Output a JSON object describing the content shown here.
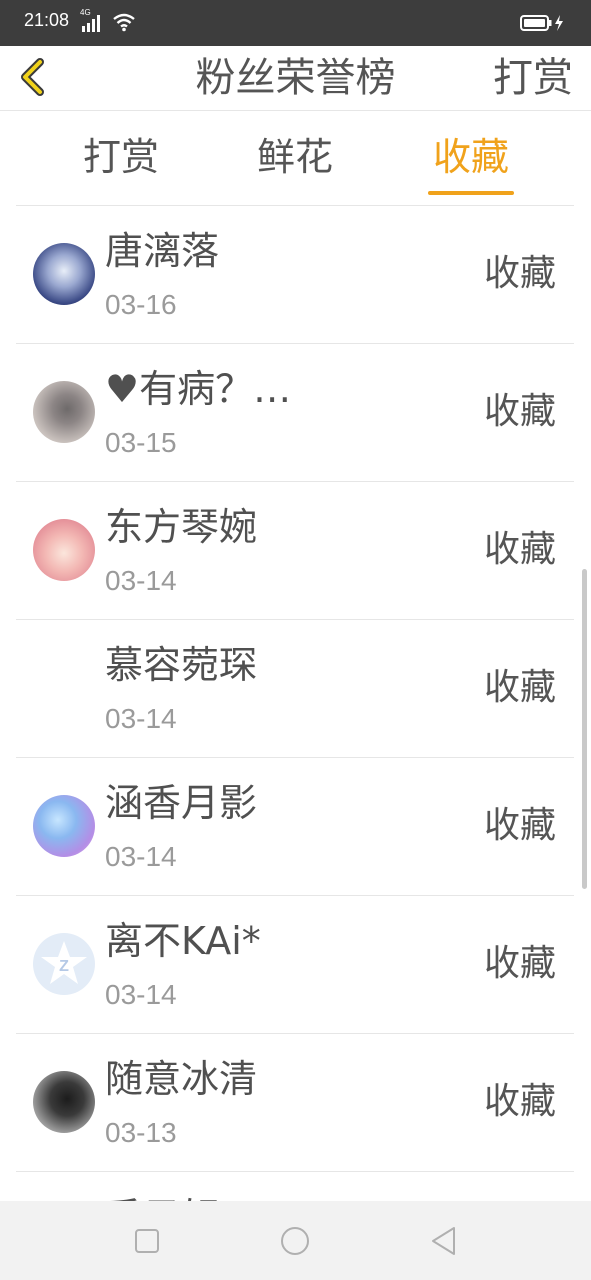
{
  "status": {
    "time": "21:08",
    "network": "4G"
  },
  "header": {
    "title": "粉丝荣誉榜",
    "action": "打赏"
  },
  "tabs": [
    {
      "label": "打赏",
      "active": false
    },
    {
      "label": "鲜花",
      "active": false
    },
    {
      "label": "收藏",
      "active": true
    }
  ],
  "colors": {
    "accent": "#f0a21b",
    "statusbar": "#3d3d3d",
    "text": "#505050",
    "muted": "#9a9a9a"
  },
  "list": [
    {
      "name": "唐漓落",
      "date": "03-16",
      "action": "收藏"
    },
    {
      "name": "♥有病？…",
      "date": "03-15",
      "action": "收藏"
    },
    {
      "name": "东方琴婉",
      "date": "03-14",
      "action": "收藏"
    },
    {
      "name": "慕容菀琛",
      "date": "03-14",
      "action": "收藏"
    },
    {
      "name": "涵香月影",
      "date": "03-14",
      "action": "收藏"
    },
    {
      "name": "离不KAi*",
      "date": "03-14",
      "action": "收藏"
    },
    {
      "name": "随意冰清",
      "date": "03-13",
      "action": "收藏"
    },
    {
      "name": "香子轩",
      "date": "",
      "action": ""
    }
  ]
}
